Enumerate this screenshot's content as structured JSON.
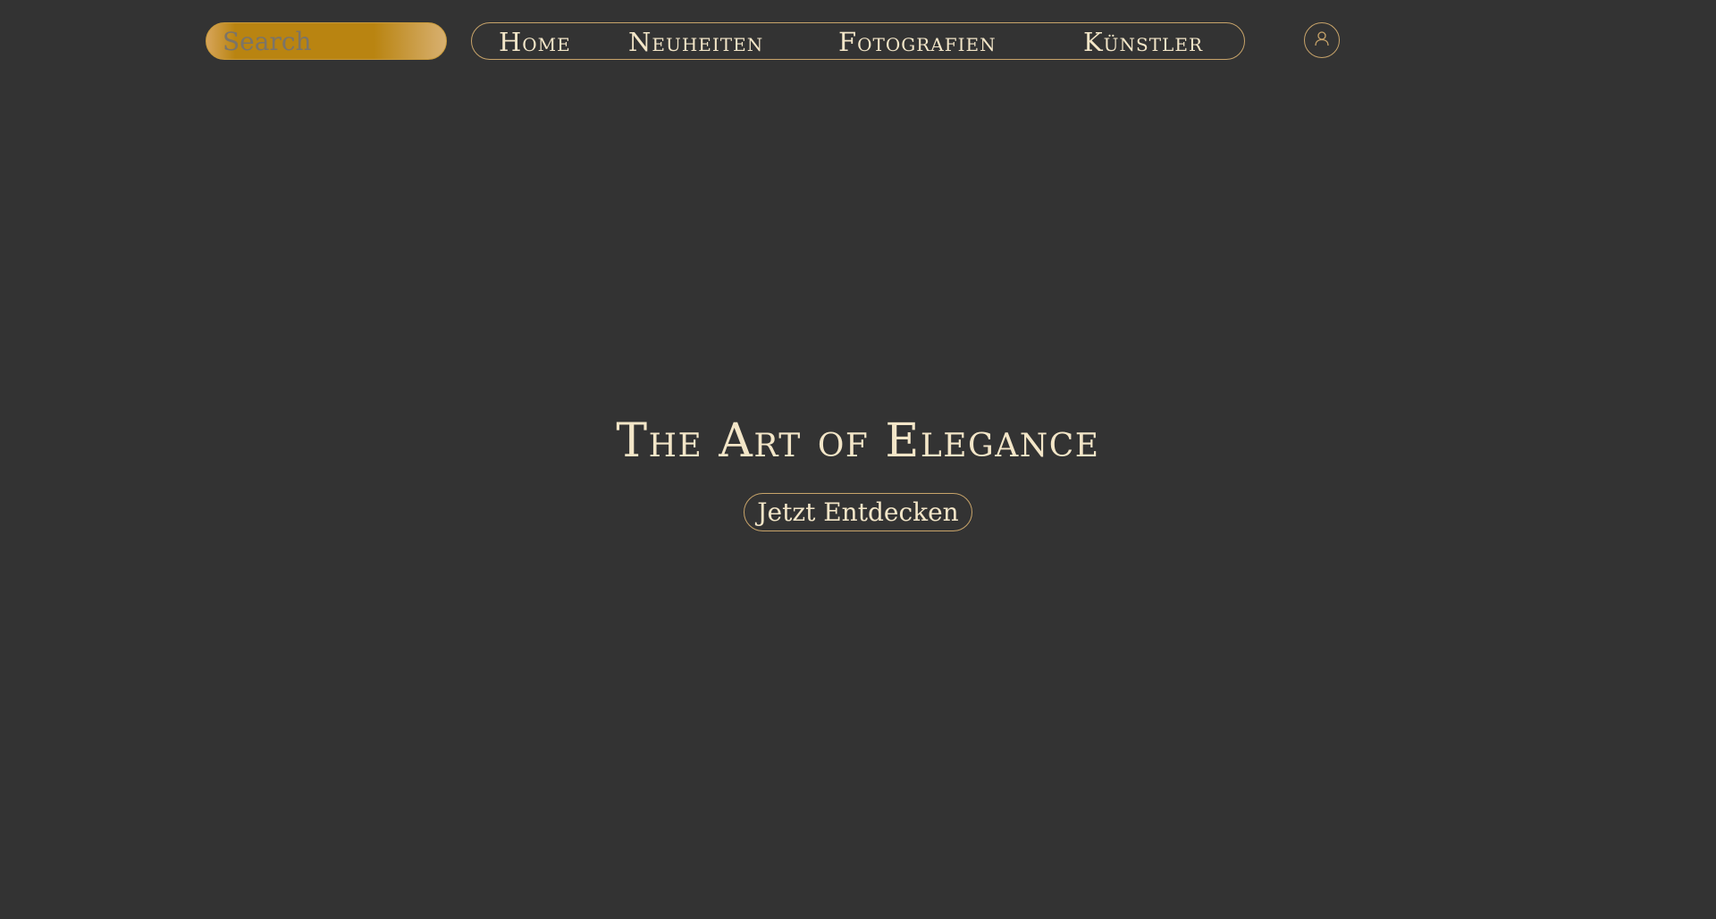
{
  "search": {
    "placeholder": "Search",
    "value": ""
  },
  "nav": {
    "items": [
      {
        "label": "Home"
      },
      {
        "label": "Neuheiten"
      },
      {
        "label": "Fotografien"
      },
      {
        "label": "Künstler"
      }
    ]
  },
  "user": {
    "icon": "user-icon"
  },
  "hero": {
    "title": "The Art of Elegance",
    "cta_label": "Jetzt Entdecken"
  },
  "colors": {
    "background": "#333333",
    "text": "#f3e6c8",
    "gold_border": "#c8a46a",
    "search_gold": "#b98411"
  }
}
